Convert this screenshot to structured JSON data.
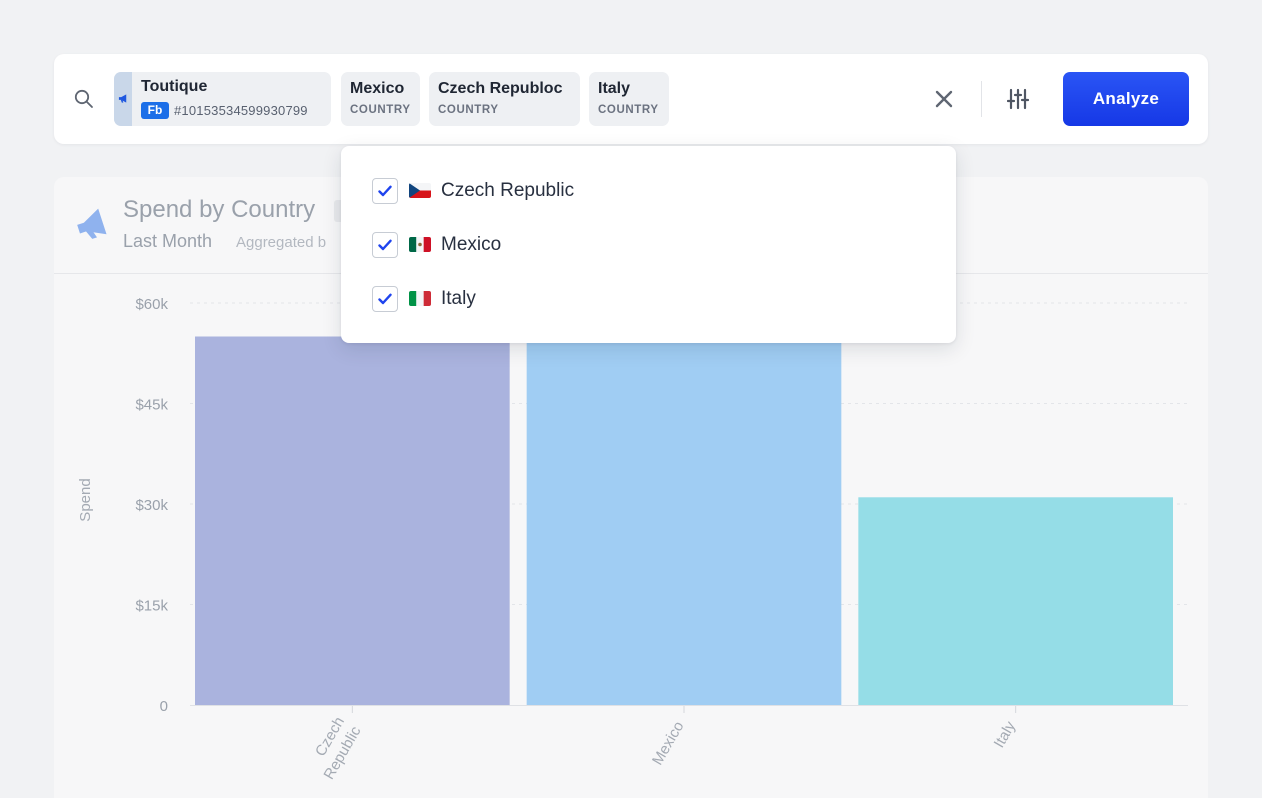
{
  "search": {
    "account_chip": {
      "name": "Toutique",
      "platform_badge": "Fb",
      "account_id": "#10153534599930799"
    },
    "filter_chips": [
      {
        "label": "Mexico",
        "type": "COUNTRY"
      },
      {
        "label": "Czech Republoc",
        "type": "COUNTRY"
      },
      {
        "label": "Italy",
        "type": "COUNTRY"
      }
    ],
    "analyze_label": "Analyze"
  },
  "dropdown": {
    "items": [
      {
        "label": "Czech Republic",
        "checked": true,
        "flag": "czech-flag-icon"
      },
      {
        "label": "Mexico",
        "checked": true,
        "flag": "mexico-flag-icon"
      },
      {
        "label": "Italy",
        "checked": true,
        "flag": "italy-flag-icon"
      }
    ]
  },
  "card": {
    "title": "Spend by Country",
    "period": "Last Month",
    "aggregation": "Aggregated b"
  },
  "colors": {
    "accent": "#1f44ee",
    "bar_czech": "#aab3de",
    "bar_mexico": "#a0cdf3",
    "bar_italy": "#95dde7"
  },
  "chart_data": {
    "type": "bar",
    "categories": [
      "Czech Republic",
      "Mexico",
      "Italy"
    ],
    "values": [
      55000,
      55000,
      31000
    ],
    "ylabel": "Spend",
    "ylim": [
      0,
      60000
    ],
    "yticks": [
      "0",
      "$15k",
      "$30k",
      "$45k",
      "$60k"
    ],
    "ytick_values": [
      0,
      15000,
      30000,
      45000,
      60000
    ],
    "xtick_lines": [
      [
        "Czech",
        "Republic"
      ],
      [
        "Mexico"
      ],
      [
        "Italy"
      ]
    ],
    "grid": true
  }
}
